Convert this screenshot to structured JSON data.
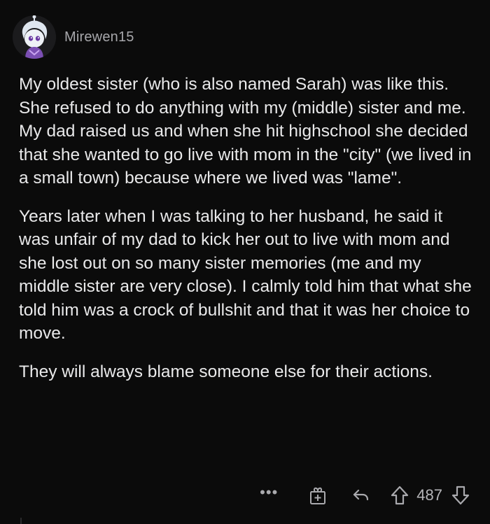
{
  "comment": {
    "author": "Mirewen15",
    "paragraphs": [
      "My oldest sister (who is also named Sarah) was like this.  She refused to do anything with my (middle) sister and me.  My dad raised us and when she hit highschool she decided that she wanted to go live with mom in the \"city\" (we lived in a small town) because where we lived was \"lame\".",
      "Years later when I was talking to her husband, he said it was unfair of my dad to kick her out to live with mom and she lost out on so many sister memories (me and my middle sister are very close).  I calmly told him that what she told him was a crock of bullshit and that it was her choice to move.",
      "They will always blame someone else for their actions."
    ],
    "actions": {
      "more_label": "•••",
      "score": "487"
    }
  },
  "icons": {
    "avatar": "snoo-avatar-icon",
    "more": "more-options-icon",
    "award": "award-gift-icon",
    "reply": "reply-arrow-icon",
    "upvote": "upvote-arrow-icon",
    "downvote": "downvote-arrow-icon"
  },
  "colors": {
    "background": "#0b0b0b",
    "text": "#e9e9ea",
    "muted": "#a9a9ad"
  }
}
